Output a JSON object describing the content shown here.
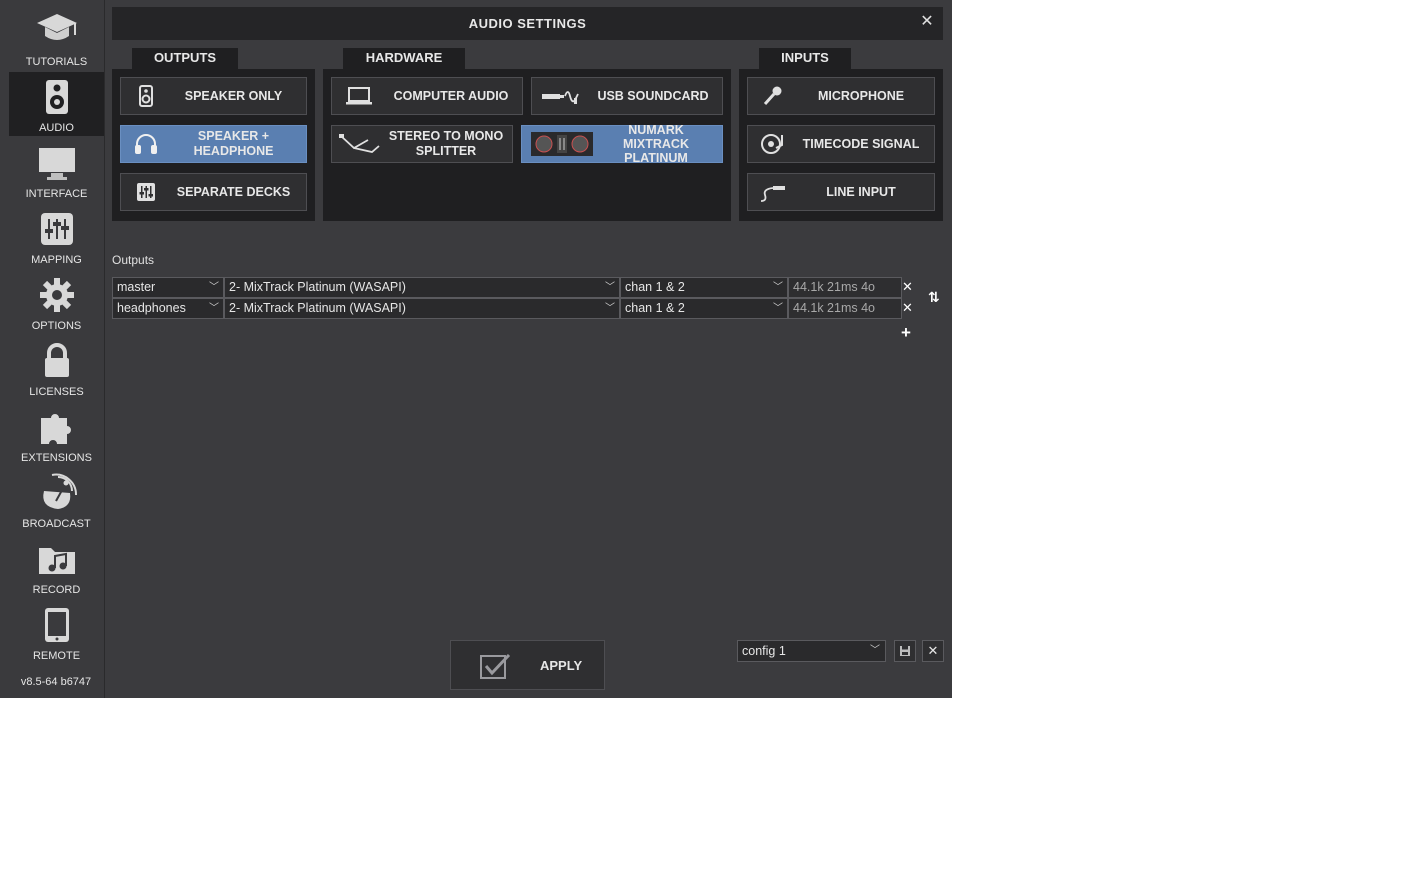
{
  "sidebar": {
    "items": [
      {
        "label": "TUTORIALS",
        "icon": "graduation-cap-icon"
      },
      {
        "label": "AUDIO",
        "icon": "speaker-icon"
      },
      {
        "label": "INTERFACE",
        "icon": "monitor-icon"
      },
      {
        "label": "MAPPING",
        "icon": "sliders-icon"
      },
      {
        "label": "OPTIONS",
        "icon": "gear-icon"
      },
      {
        "label": "LICENSES",
        "icon": "lock-icon"
      },
      {
        "label": "EXTENSIONS",
        "icon": "puzzle-icon"
      },
      {
        "label": "BROADCAST",
        "icon": "satellite-dish-icon"
      },
      {
        "label": "RECORD",
        "icon": "music-folder-icon"
      },
      {
        "label": "REMOTE",
        "icon": "tablet-icon"
      }
    ],
    "active": "AUDIO",
    "version": "v8.5-64 b6747"
  },
  "header": {
    "title": "AUDIO SETTINGS"
  },
  "tabs": {
    "outputs": "OUTPUTS",
    "hardware": "HARDWARE",
    "inputs": "INPUTS"
  },
  "outputs_buttons": {
    "speaker_only": "SPEAKER ONLY",
    "speaker_headphone": "SPEAKER + HEADPHONE",
    "separate_decks": "SEPARATE DECKS"
  },
  "hardware_buttons": {
    "computer_audio": "COMPUTER AUDIO",
    "usb_soundcard": "USB SOUNDCARD",
    "stereo_mono": "STEREO TO MONO SPLITTER",
    "numark": "NUMARK MIXTRACK PLATINUM"
  },
  "inputs_buttons": {
    "microphone": "MICROPHONE",
    "timecode": "TIMECODE SIGNAL",
    "line_input": "LINE INPUT"
  },
  "selected": [
    "SPEAKER + HEADPHONE",
    "NUMARK MIXTRACK PLATINUM"
  ],
  "outputs_section": {
    "label": "Outputs",
    "rows": [
      {
        "channel": "master",
        "device": "2- MixTrack Platinum (WASAPI)",
        "chan": "chan 1 & 2",
        "info": "44.1k 21ms 4o"
      },
      {
        "channel": "headphones",
        "device": "2- MixTrack Platinum (WASAPI)",
        "chan": "chan 1 & 2",
        "info": "44.1k 21ms 4o"
      }
    ]
  },
  "footer": {
    "apply": "APPLY",
    "config": "config 1"
  },
  "colors": {
    "background": "#3b3b3e",
    "panel": "#1f1f21",
    "selected": "#5a7fb1"
  }
}
